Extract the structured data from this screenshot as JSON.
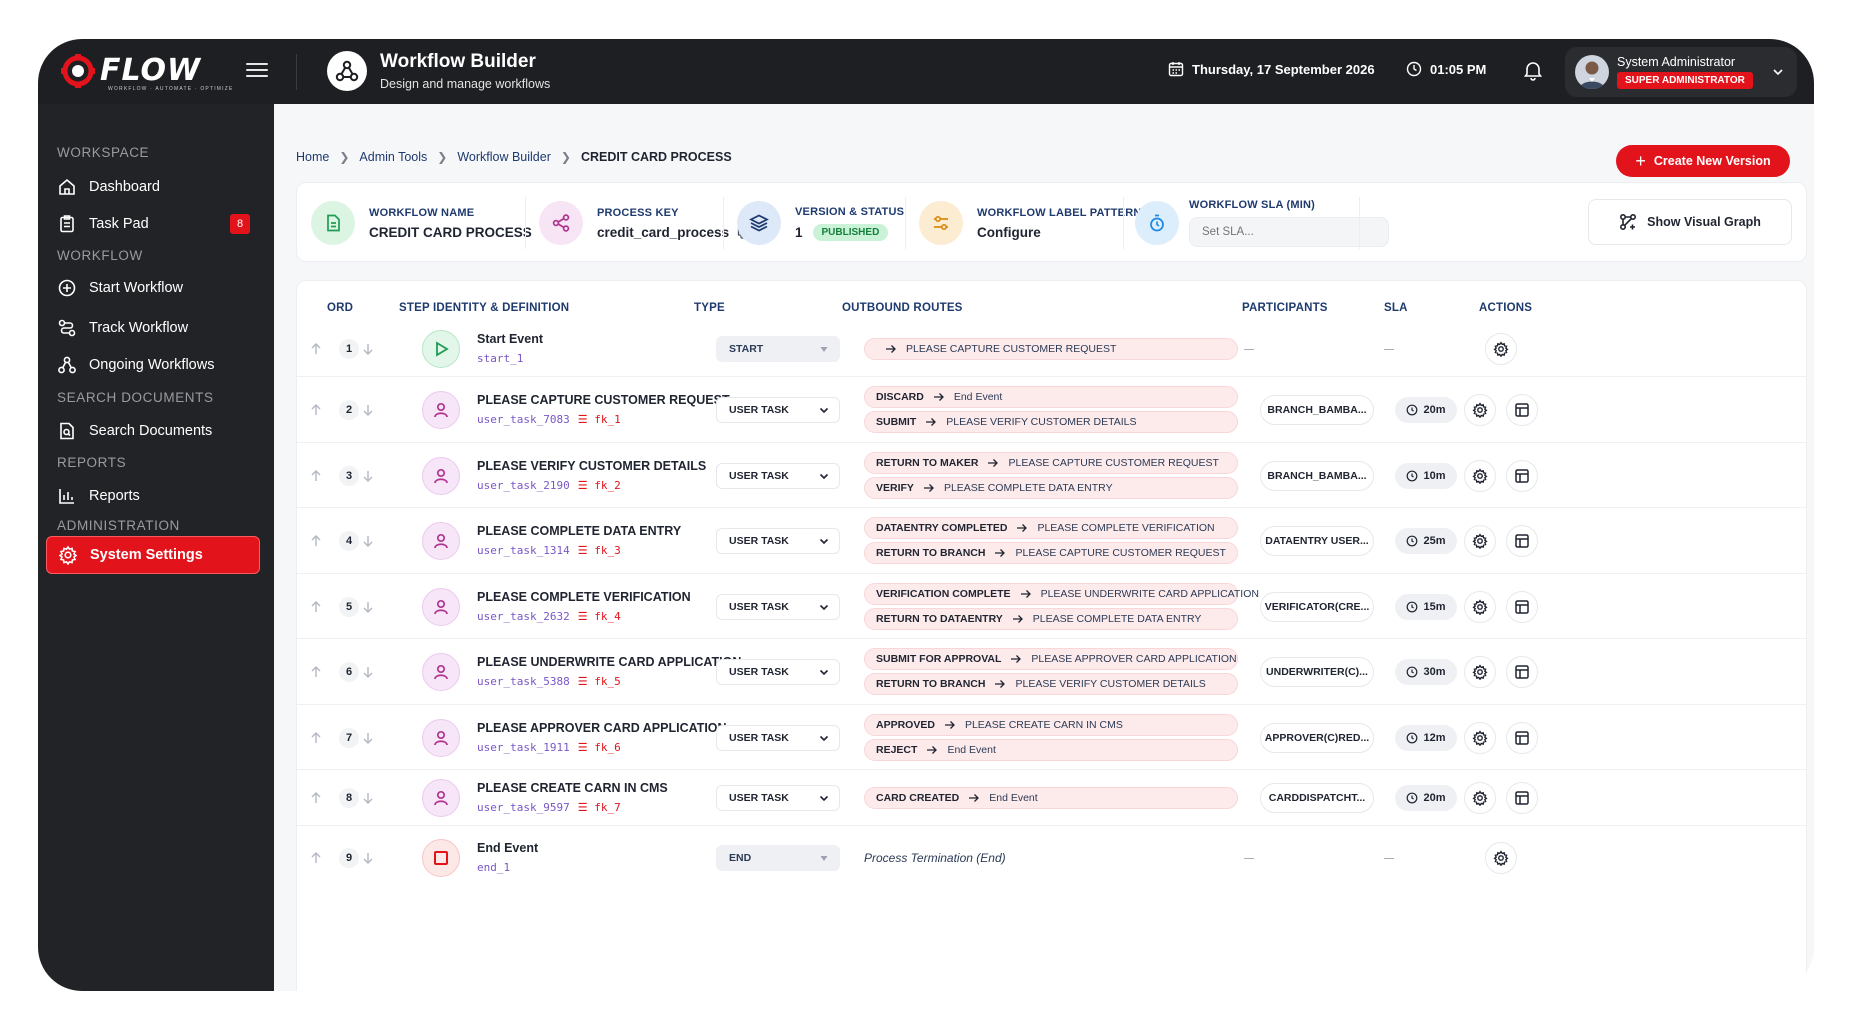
{
  "brand": {
    "name": "FLOW",
    "tagline": "WORKFLOW · AUTOMATE · OPTIMIZE"
  },
  "app": {
    "title": "Workflow Builder",
    "subtitle": "Design and manage workflows"
  },
  "topbar": {
    "date": "Thursday, 17 September 2026",
    "time": "01:05 PM",
    "user_name": "System Administrator",
    "user_role": "SUPER ADMINISTRATOR"
  },
  "sidebar": {
    "sections": [
      {
        "title": "WORKSPACE",
        "items": [
          {
            "label": "Dashboard",
            "icon": "home-icon"
          },
          {
            "label": "Task Pad",
            "icon": "clipboard-icon",
            "badge": "8"
          }
        ]
      },
      {
        "title": "WORKFLOW",
        "items": [
          {
            "label": "Start Workflow",
            "icon": "plus-circle-icon"
          },
          {
            "label": "Track Workflow",
            "icon": "route-icon"
          },
          {
            "label": "Ongoing Workflows",
            "icon": "hierarchy-icon"
          }
        ]
      },
      {
        "title": "SEARCH DOCUMENTS",
        "items": [
          {
            "label": "Search Documents",
            "icon": "document-search-icon"
          }
        ]
      },
      {
        "title": "REPORTS",
        "items": [
          {
            "label": "Reports",
            "icon": "bar-chart-icon"
          }
        ]
      },
      {
        "title": "ADMINISTRATION",
        "items": [
          {
            "label": "System Settings",
            "icon": "gear-icon",
            "active": true
          }
        ]
      }
    ]
  },
  "breadcrumb": {
    "items": [
      "Home",
      "Admin Tools",
      "Workflow Builder"
    ],
    "current": "CREDIT CARD PROCESS"
  },
  "actions": {
    "create_version": "Create New Version",
    "show_graph": "Show Visual Graph"
  },
  "info": {
    "workflow_name_label": "WORKFLOW NAME",
    "workflow_name": "CREDIT CARD PROCESS",
    "process_key_label": "PROCESS KEY",
    "process_key": "credit_card_process",
    "version_label": "VERSION & STATUS",
    "version": "1",
    "status": "PUBLISHED",
    "label_pattern_label": "WORKFLOW LABEL PATTERN",
    "label_pattern": "Configure",
    "sla_label": "WORKFLOW SLA (MIN)",
    "sla_placeholder": "Set SLA..."
  },
  "table": {
    "headers": {
      "ord": "ORD",
      "step": "STEP IDENTITY & DEFINITION",
      "type": "TYPE",
      "routes": "OUTBOUND ROUTES",
      "participants": "PARTICIPANTS",
      "sla": "SLA",
      "actions": "ACTIONS"
    },
    "rows": [
      {
        "ord": "1",
        "name": "Start Event",
        "id": "start_1",
        "fk": "",
        "type": "START",
        "kind": "start",
        "routes": [
          {
            "label": "",
            "target": "PLEASE CAPTURE CUSTOMER REQUEST"
          }
        ],
        "participant": "",
        "sla": ""
      },
      {
        "ord": "2",
        "name": "PLEASE CAPTURE CUSTOMER REQUEST",
        "id": "user_task_7083",
        "fk": "fk_1",
        "type": "USER TASK",
        "kind": "task",
        "routes": [
          {
            "label": "DISCARD",
            "target": "End Event"
          },
          {
            "label": "SUBMIT",
            "target": "PLEASE VERIFY CUSTOMER DETAILS"
          }
        ],
        "participant": "BRANCH_BAMBA...",
        "sla": "20m"
      },
      {
        "ord": "3",
        "name": "PLEASE VERIFY CUSTOMER DETAILS",
        "id": "user_task_2190",
        "fk": "fk_2",
        "type": "USER TASK",
        "kind": "task",
        "routes": [
          {
            "label": "RETURN TO MAKER",
            "target": "PLEASE CAPTURE CUSTOMER REQUEST"
          },
          {
            "label": "VERIFY",
            "target": "PLEASE COMPLETE DATA ENTRY"
          }
        ],
        "participant": "BRANCH_BAMBA...",
        "sla": "10m"
      },
      {
        "ord": "4",
        "name": "PLEASE COMPLETE DATA ENTRY",
        "id": "user_task_1314",
        "fk": "fk_3",
        "type": "USER TASK",
        "kind": "task",
        "routes": [
          {
            "label": "DATAENTRY COMPLETED",
            "target": "PLEASE COMPLETE VERIFICATION"
          },
          {
            "label": "RETURN TO BRANCH",
            "target": "PLEASE CAPTURE CUSTOMER REQUEST"
          }
        ],
        "participant": "DATAENTRY USER...",
        "sla": "25m"
      },
      {
        "ord": "5",
        "name": "PLEASE COMPLETE VERIFICATION",
        "id": "user_task_2632",
        "fk": "fk_4",
        "type": "USER TASK",
        "kind": "task",
        "routes": [
          {
            "label": "VERIFICATION COMPLETE",
            "target": "PLEASE UNDERWRITE CARD APPLICATION"
          },
          {
            "label": "RETURN TO DATAENTRY",
            "target": "PLEASE COMPLETE DATA ENTRY"
          }
        ],
        "participant": "VERIFICATOR(CRE...",
        "sla": "15m"
      },
      {
        "ord": "6",
        "name": "PLEASE UNDERWRITE CARD APPLICATION",
        "id": "user_task_5388",
        "fk": "fk_5",
        "type": "USER TASK",
        "kind": "task",
        "routes": [
          {
            "label": "SUBMIT FOR APPROVAL",
            "target": "PLEASE APPROVER CARD APPLICATION"
          },
          {
            "label": "RETURN TO BRANCH",
            "target": "PLEASE VERIFY CUSTOMER DETAILS"
          }
        ],
        "participant": "UNDERWRITER(C)...",
        "sla": "30m"
      },
      {
        "ord": "7",
        "name": "PLEASE APPROVER CARD APPLICATION",
        "id": "user_task_1911",
        "fk": "fk_6",
        "type": "USER TASK",
        "kind": "task",
        "routes": [
          {
            "label": "APPROVED",
            "target": "PLEASE CREATE CARN IN CMS"
          },
          {
            "label": "REJECT",
            "target": "End Event"
          }
        ],
        "participant": "APPROVER(C)RED...",
        "sla": "12m"
      },
      {
        "ord": "8",
        "name": "PLEASE CREATE CARN IN CMS",
        "id": "user_task_9597",
        "fk": "fk_7",
        "type": "USER TASK",
        "kind": "task",
        "routes": [
          {
            "label": "CARD CREATED",
            "target": "End Event"
          }
        ],
        "participant": "CARDDISPATCHT...",
        "sla": "20m"
      },
      {
        "ord": "9",
        "name": "End Event",
        "id": "end_1",
        "fk": "",
        "type": "END",
        "kind": "end",
        "routes": [],
        "route_text": "Process Termination (End)",
        "participant": "",
        "sla": ""
      }
    ]
  },
  "colors": {
    "accent": "#e3131b",
    "sidebar": "#222326",
    "topbar": "#1e1f22",
    "label_blue": "#1e3a6e",
    "published_bg": "#c9f2d7",
    "route_bg": "#fdebec"
  }
}
